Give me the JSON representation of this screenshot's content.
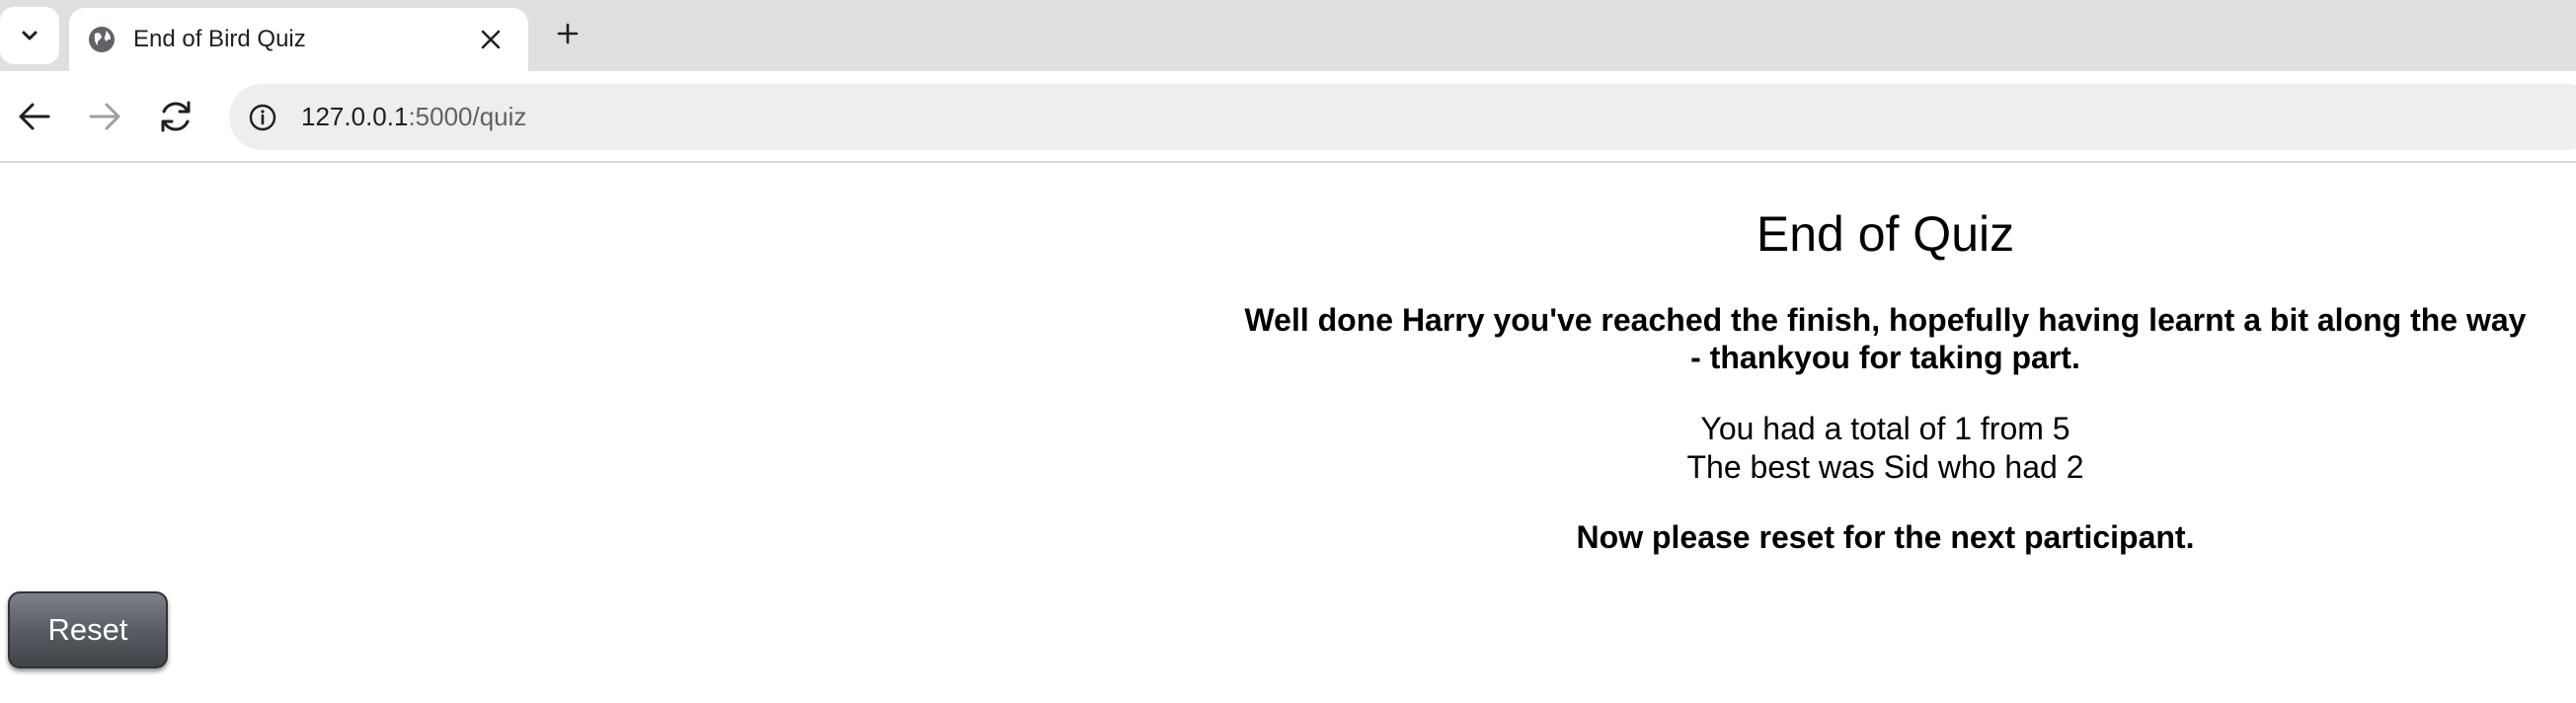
{
  "browser": {
    "tab": {
      "title": "End of Bird Quiz"
    },
    "address_bar": {
      "host": "127.0.0.1",
      "path": ":5000/quiz"
    }
  },
  "quiz_end": {
    "title": "End of Quiz",
    "message_line1": "Well done Harry you've reached the finish, hopefully having learnt a bit along the way",
    "message_line2": "- thankyou for taking part.",
    "score_line": "You had a total of 1 from 5",
    "best_line": "The best was Sid who had 2",
    "reset_note": "Now please reset for the next participant.",
    "reset_button_label": "Reset"
  },
  "icons": {
    "tab_search": "chevron-down-icon",
    "favicon": "globe-icon",
    "tab_close": "close-icon",
    "new_tab": "plus-icon",
    "back": "back-arrow-icon",
    "forward": "forward-arrow-icon",
    "reload": "reload-icon",
    "site_info": "info-icon"
  },
  "colors": {
    "tabstrip": "#dfdfdf",
    "omnibox": "#efeded",
    "reset_button": "#565b61",
    "text": "#000000"
  }
}
